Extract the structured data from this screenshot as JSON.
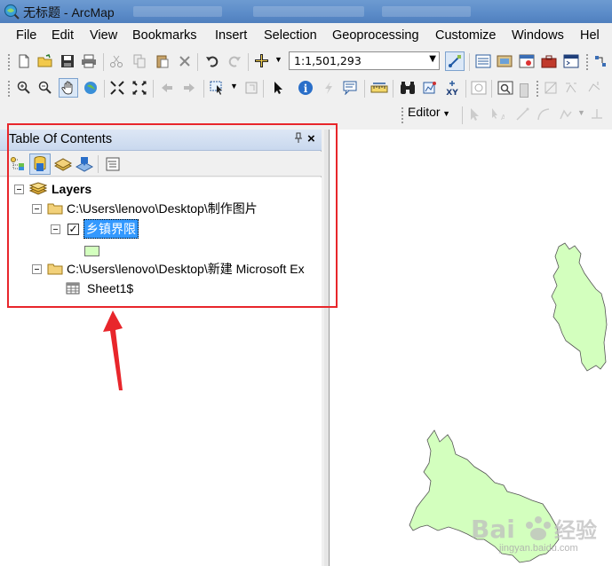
{
  "window": {
    "title": "无标题 - ArcMap"
  },
  "menu": {
    "items": [
      "File",
      "Edit",
      "View",
      "Bookmarks",
      "Insert",
      "Selection",
      "Geoprocessing",
      "Customize",
      "Windows",
      "Hel"
    ]
  },
  "standard_toolbar": {
    "scale": "1:1,501,293",
    "icons": [
      "new-document-icon",
      "open-folder-icon",
      "save-icon",
      "print-icon",
      "cut-icon",
      "copy-icon",
      "paste-icon",
      "delete-icon",
      "undo-icon",
      "redo-icon",
      "add-data-icon",
      "editor-toolbar-icon",
      "table-of-contents-icon",
      "catalog-icon",
      "search-window-icon",
      "arctoolbox-icon",
      "python-icon"
    ]
  },
  "tools_toolbar": {
    "icons": [
      "zoom-in-icon",
      "zoom-out-icon",
      "pan-icon",
      "full-extent-icon",
      "fixed-zoom-in-icon",
      "fixed-zoom-out-icon",
      "back-icon",
      "forward-icon",
      "select-features-icon",
      "clear-selection-icon",
      "select-elements-icon",
      "identify-icon",
      "hyperlink-icon",
      "html-popup-icon",
      "measure-icon",
      "find-icon",
      "find-route-icon",
      "go-to-xy-icon",
      "time-slider-icon",
      "viewer-window-icon"
    ]
  },
  "editor_toolbar": {
    "label": "Editor"
  },
  "toc": {
    "title": "Table Of Contents",
    "pin": "ᵖ",
    "close": "×",
    "tree": {
      "root": "Layers",
      "group1": "C:\\Users\\lenovo\\Desktop\\制作图片",
      "layer1": "乡镇界限",
      "group2": "C:\\Users\\lenovo\\Desktop\\新建 Microsoft Ex",
      "table1": "Sheet1$"
    }
  },
  "colors": {
    "polygon_fill": "#d3ffbe",
    "annotation_red": "#e8262b",
    "selection_blue": "#3399ff"
  },
  "watermark": {
    "text": "Bai 经验",
    "url": "jingyan.baidu.com"
  }
}
